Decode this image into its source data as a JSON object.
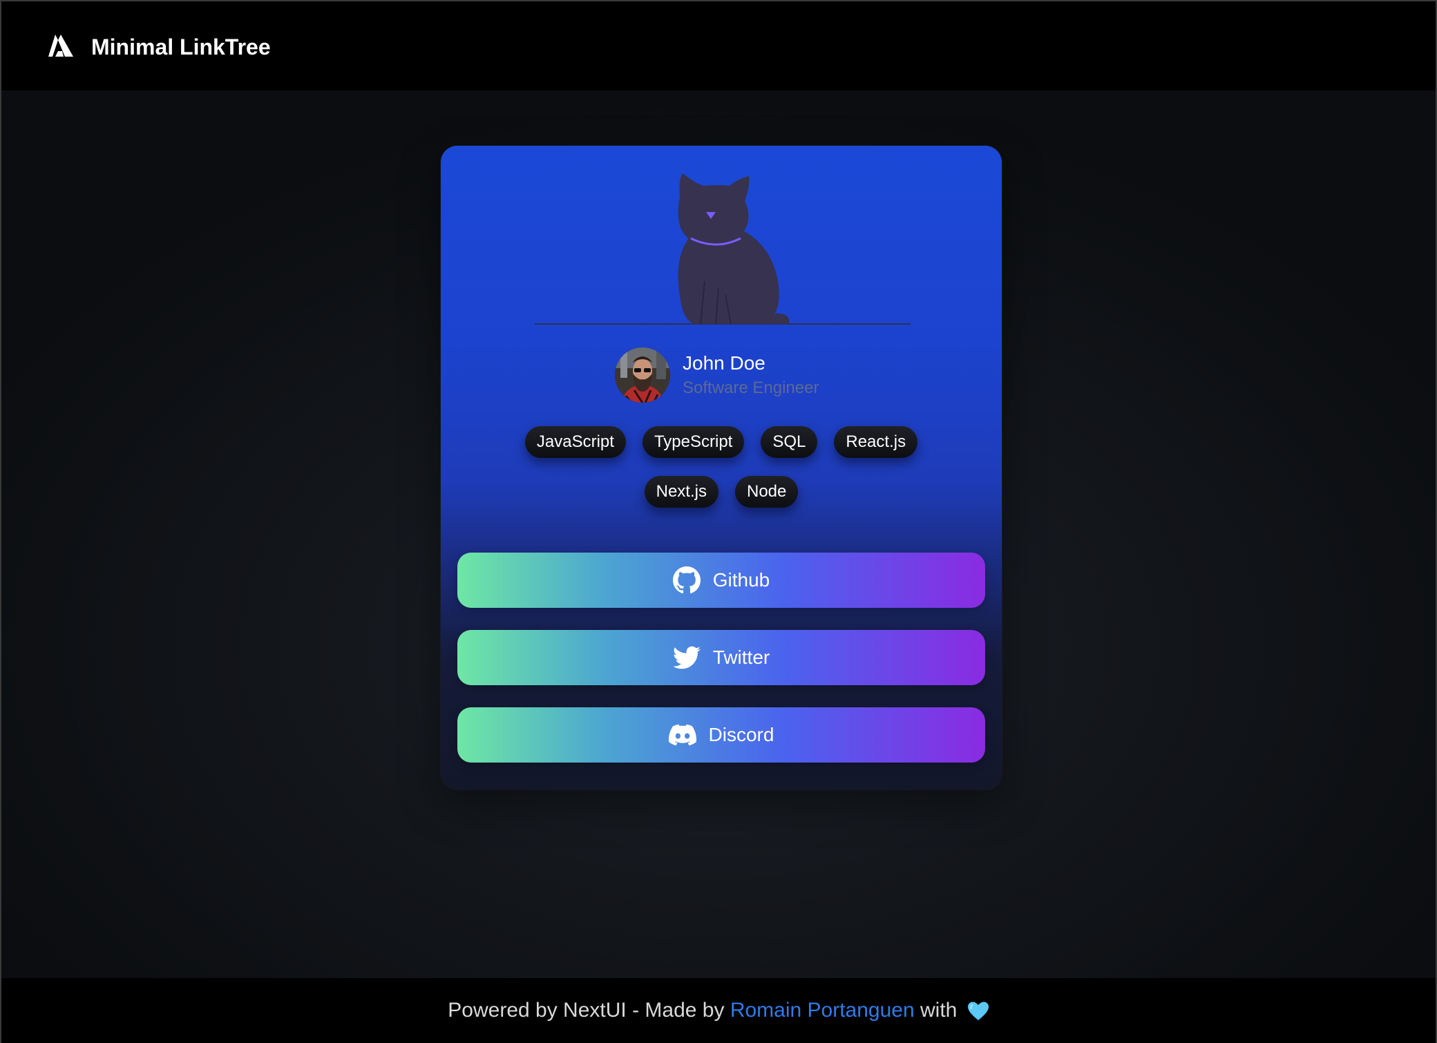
{
  "header": {
    "brand": "Minimal LinkTree",
    "logo_icon": "triangle-logo-icon"
  },
  "card": {
    "illustration": "sitting-cat-illustration",
    "profile": {
      "name": "John Doe",
      "role": "Software Engineer",
      "avatar": "bearded-man-avatar"
    },
    "tags_row1": [
      "JavaScript",
      "TypeScript",
      "SQL",
      "React.js"
    ],
    "tags_row2": [
      "Next.js",
      "Node"
    ],
    "links": [
      {
        "label": "Github",
        "icon": "github-icon"
      },
      {
        "label": "Twitter",
        "icon": "twitter-icon"
      },
      {
        "label": "Discord",
        "icon": "discord-icon"
      }
    ]
  },
  "footer": {
    "prefix": "Powered by NextUI - Made by ",
    "author": "Romain Portanguen",
    "suffix": " with",
    "heart_icon": "blue-heart-icon"
  },
  "colors": {
    "card_top": "#1b49d6",
    "button_gradient_start": "#6ee7a4",
    "button_gradient_end": "#8a2be2",
    "author_link": "#2f7be8",
    "role_text": "#5b6a93"
  }
}
